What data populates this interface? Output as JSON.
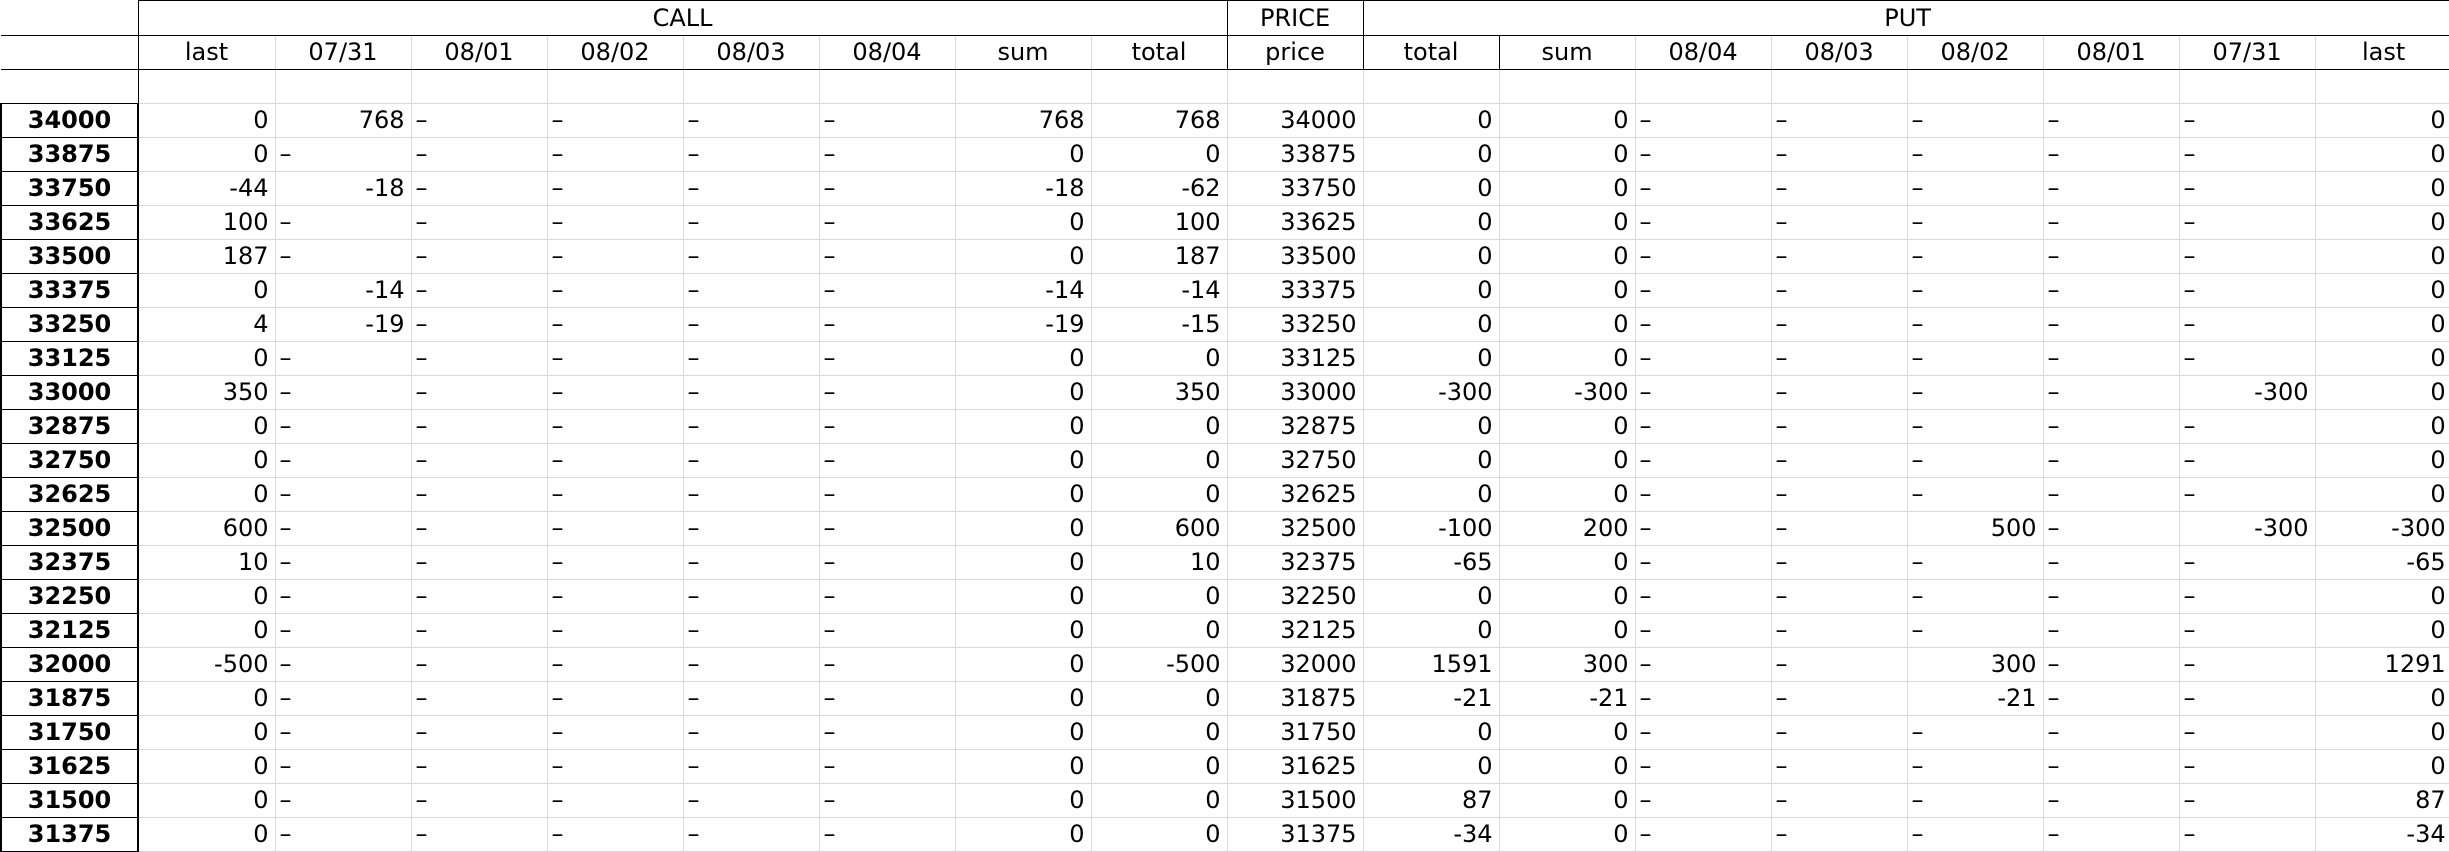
{
  "groups": {
    "call": "CALL",
    "price": "PRICE",
    "put": "PUT"
  },
  "columns": [
    "last",
    "07/31",
    "08/01",
    "08/02",
    "08/03",
    "08/04",
    "sum",
    "total",
    "price",
    "total",
    "sum",
    "08/04",
    "08/03",
    "08/02",
    "08/01",
    "07/31",
    "last"
  ],
  "rows": [
    {
      "label": "34000",
      "cells": [
        "0",
        "768",
        "–",
        "–",
        "–",
        "–",
        "768",
        "768",
        "34000",
        "0",
        "0",
        "–",
        "–",
        "–",
        "–",
        "–",
        "0"
      ]
    },
    {
      "label": "33875",
      "cells": [
        "0",
        "–",
        "–",
        "–",
        "–",
        "–",
        "0",
        "0",
        "33875",
        "0",
        "0",
        "–",
        "–",
        "–",
        "–",
        "–",
        "0"
      ]
    },
    {
      "label": "33750",
      "cells": [
        "-44",
        "-18",
        "–",
        "–",
        "–",
        "–",
        "-18",
        "-62",
        "33750",
        "0",
        "0",
        "–",
        "–",
        "–",
        "–",
        "–",
        "0"
      ]
    },
    {
      "label": "33625",
      "cells": [
        "100",
        "–",
        "–",
        "–",
        "–",
        "–",
        "0",
        "100",
        "33625",
        "0",
        "0",
        "–",
        "–",
        "–",
        "–",
        "–",
        "0"
      ]
    },
    {
      "label": "33500",
      "cells": [
        "187",
        "–",
        "–",
        "–",
        "–",
        "–",
        "0",
        "187",
        "33500",
        "0",
        "0",
        "–",
        "–",
        "–",
        "–",
        "–",
        "0"
      ]
    },
    {
      "label": "33375",
      "cells": [
        "0",
        "-14",
        "–",
        "–",
        "–",
        "–",
        "-14",
        "-14",
        "33375",
        "0",
        "0",
        "–",
        "–",
        "–",
        "–",
        "–",
        "0"
      ]
    },
    {
      "label": "33250",
      "cells": [
        "4",
        "-19",
        "–",
        "–",
        "–",
        "–",
        "-19",
        "-15",
        "33250",
        "0",
        "0",
        "–",
        "–",
        "–",
        "–",
        "–",
        "0"
      ]
    },
    {
      "label": "33125",
      "cells": [
        "0",
        "–",
        "–",
        "–",
        "–",
        "–",
        "0",
        "0",
        "33125",
        "0",
        "0",
        "–",
        "–",
        "–",
        "–",
        "–",
        "0"
      ]
    },
    {
      "label": "33000",
      "cells": [
        "350",
        "–",
        "–",
        "–",
        "–",
        "–",
        "0",
        "350",
        "33000",
        "-300",
        "-300",
        "–",
        "–",
        "–",
        "–",
        "-300",
        "0"
      ]
    },
    {
      "label": "32875",
      "cells": [
        "0",
        "–",
        "–",
        "–",
        "–",
        "–",
        "0",
        "0",
        "32875",
        "0",
        "0",
        "–",
        "–",
        "–",
        "–",
        "–",
        "0"
      ]
    },
    {
      "label": "32750",
      "cells": [
        "0",
        "–",
        "–",
        "–",
        "–",
        "–",
        "0",
        "0",
        "32750",
        "0",
        "0",
        "–",
        "–",
        "–",
        "–",
        "–",
        "0"
      ]
    },
    {
      "label": "32625",
      "cells": [
        "0",
        "–",
        "–",
        "–",
        "–",
        "–",
        "0",
        "0",
        "32625",
        "0",
        "0",
        "–",
        "–",
        "–",
        "–",
        "–",
        "0"
      ]
    },
    {
      "label": "32500",
      "cells": [
        "600",
        "–",
        "–",
        "–",
        "–",
        "–",
        "0",
        "600",
        "32500",
        "-100",
        "200",
        "–",
        "–",
        "500",
        "–",
        "-300",
        "-300"
      ]
    },
    {
      "label": "32375",
      "cells": [
        "10",
        "–",
        "–",
        "–",
        "–",
        "–",
        "0",
        "10",
        "32375",
        "-65",
        "0",
        "–",
        "–",
        "–",
        "–",
        "–",
        "-65"
      ]
    },
    {
      "label": "32250",
      "cells": [
        "0",
        "–",
        "–",
        "–",
        "–",
        "–",
        "0",
        "0",
        "32250",
        "0",
        "0",
        "–",
        "–",
        "–",
        "–",
        "–",
        "0"
      ]
    },
    {
      "label": "32125",
      "cells": [
        "0",
        "–",
        "–",
        "–",
        "–",
        "–",
        "0",
        "0",
        "32125",
        "0",
        "0",
        "–",
        "–",
        "–",
        "–",
        "–",
        "0"
      ]
    },
    {
      "label": "32000",
      "cells": [
        "-500",
        "–",
        "–",
        "–",
        "–",
        "–",
        "0",
        "-500",
        "32000",
        "1591",
        "300",
        "–",
        "–",
        "300",
        "–",
        "–",
        "1291"
      ]
    },
    {
      "label": "31875",
      "cells": [
        "0",
        "–",
        "–",
        "–",
        "–",
        "–",
        "0",
        "0",
        "31875",
        "-21",
        "-21",
        "–",
        "–",
        "-21",
        "–",
        "–",
        "0"
      ]
    },
    {
      "label": "31750",
      "cells": [
        "0",
        "–",
        "–",
        "–",
        "–",
        "–",
        "0",
        "0",
        "31750",
        "0",
        "0",
        "–",
        "–",
        "–",
        "–",
        "–",
        "0"
      ]
    },
    {
      "label": "31625",
      "cells": [
        "0",
        "–",
        "–",
        "–",
        "–",
        "–",
        "0",
        "0",
        "31625",
        "0",
        "0",
        "–",
        "–",
        "–",
        "–",
        "–",
        "0"
      ]
    },
    {
      "label": "31500",
      "cells": [
        "0",
        "–",
        "–",
        "–",
        "–",
        "–",
        "0",
        "0",
        "31500",
        "87",
        "0",
        "–",
        "–",
        "–",
        "–",
        "–",
        "87"
      ]
    },
    {
      "label": "31375",
      "cells": [
        "0",
        "–",
        "–",
        "–",
        "–",
        "–",
        "0",
        "0",
        "31375",
        "-34",
        "0",
        "–",
        "–",
        "–",
        "–",
        "–",
        "-34"
      ]
    }
  ]
}
